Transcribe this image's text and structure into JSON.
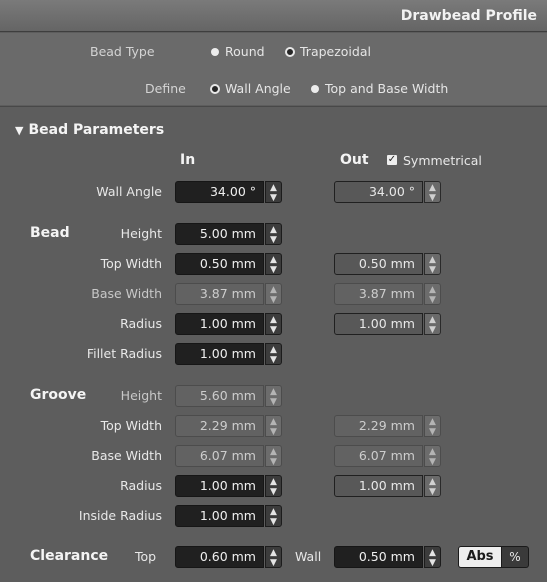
{
  "title": "Drawbead Profile",
  "bead_type": {
    "label": "Bead Type",
    "options": [
      {
        "label": "Round",
        "selected": false
      },
      {
        "label": "Trapezoidal",
        "selected": true
      }
    ]
  },
  "define": {
    "label": "Define",
    "options": [
      {
        "label": "Wall Angle",
        "selected": true
      },
      {
        "label": "Top and Base Width",
        "selected": false
      }
    ]
  },
  "section": {
    "title": "Bead Parameters",
    "expanded_glyph": "▼",
    "col_in": "In",
    "col_out": "Out",
    "symmetrical": {
      "label": "Symmetrical",
      "checked": true,
      "glyph": "✓"
    }
  },
  "wall_angle": {
    "label": "Wall Angle",
    "in": "34.00 °",
    "out": "34.00 °"
  },
  "bead": {
    "group": "Bead",
    "height": {
      "label": "Height",
      "in": "5.00 mm"
    },
    "top_width": {
      "label": "Top Width",
      "in": "0.50 mm",
      "out": "0.50 mm"
    },
    "base_width": {
      "label": "Base Width",
      "in": "3.87 mm",
      "out": "3.87 mm"
    },
    "radius": {
      "label": "Radius",
      "in": "1.00 mm",
      "out": "1.00 mm"
    },
    "fillet_radius": {
      "label": "Fillet Radius",
      "in": "1.00 mm"
    }
  },
  "groove": {
    "group": "Groove",
    "height": {
      "label": "Height",
      "in": "5.60 mm"
    },
    "top_width": {
      "label": "Top Width",
      "in": "2.29 mm",
      "out": "2.29 mm"
    },
    "base_width": {
      "label": "Base Width",
      "in": "6.07 mm",
      "out": "6.07 mm"
    },
    "radius": {
      "label": "Radius",
      "in": "1.00 mm",
      "out": "1.00 mm"
    },
    "inside_radius": {
      "label": "Inside Radius",
      "in": "1.00 mm"
    }
  },
  "clearance": {
    "group": "Clearance",
    "top": {
      "label": "Top",
      "value": "0.60 mm"
    },
    "wall": {
      "label": "Wall",
      "value": "0.50 mm"
    },
    "abs_label": "Abs",
    "pct_label": "%"
  },
  "spinner_glyphs": {
    "up": "▲",
    "down": "▼"
  }
}
